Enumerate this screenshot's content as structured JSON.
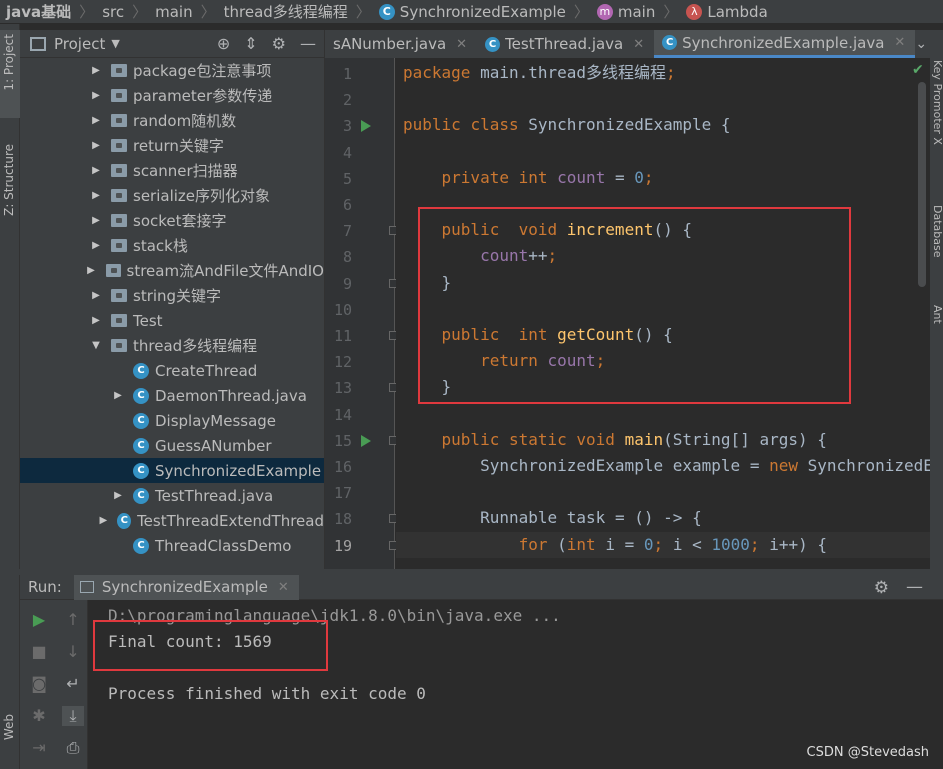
{
  "breadcrumb": [
    "java基础",
    "src",
    "main",
    "thread多线程编程",
    "SynchronizedExample",
    "main",
    "Lambda"
  ],
  "left_strip": {
    "project": "1: Project",
    "structure": "Z: Structure",
    "web": "Web"
  },
  "right_strip": {
    "key_promoter": "Key Promoter X",
    "database": "Database",
    "ant": "Ant"
  },
  "project_panel": {
    "title": "Project",
    "items": [
      {
        "label": "package包注意事项",
        "kind": "folder",
        "arrow": "▶"
      },
      {
        "label": "parameter参数传递",
        "kind": "folder",
        "arrow": "▶"
      },
      {
        "label": "random随机数",
        "kind": "folder",
        "arrow": "▶"
      },
      {
        "label": "return关键字",
        "kind": "folder",
        "arrow": "▶"
      },
      {
        "label": "scanner扫描器",
        "kind": "folder",
        "arrow": "▶"
      },
      {
        "label": "serialize序列化对象",
        "kind": "folder",
        "arrow": "▶"
      },
      {
        "label": "socket套接字",
        "kind": "folder",
        "arrow": "▶"
      },
      {
        "label": "stack栈",
        "kind": "folder",
        "arrow": "▶"
      },
      {
        "label": "stream流AndFile文件AndIO",
        "kind": "folder",
        "arrow": "▶"
      },
      {
        "label": "string关键字",
        "kind": "folder",
        "arrow": "▶"
      },
      {
        "label": "Test",
        "kind": "folder",
        "arrow": "▶"
      },
      {
        "label": "thread多线程编程",
        "kind": "folder",
        "arrow": "▼"
      },
      {
        "label": "CreateThread",
        "kind": "class",
        "arrow": ""
      },
      {
        "label": "DaemonThread.java",
        "kind": "class",
        "arrow": "▶"
      },
      {
        "label": "DisplayMessage",
        "kind": "class",
        "arrow": ""
      },
      {
        "label": "GuessANumber",
        "kind": "class",
        "arrow": ""
      },
      {
        "label": "SynchronizedExample",
        "kind": "class",
        "arrow": "",
        "selected": true
      },
      {
        "label": "TestThread.java",
        "kind": "class",
        "arrow": "▶"
      },
      {
        "label": "TestThreadExtendThread",
        "kind": "class",
        "arrow": "▶"
      },
      {
        "label": "ThreadClassDemo",
        "kind": "class",
        "arrow": ""
      }
    ]
  },
  "tabs": [
    {
      "label": "sANumber.java",
      "active": false
    },
    {
      "label": "TestThread.java",
      "active": false
    },
    {
      "label": "SynchronizedExample.java",
      "active": true
    }
  ],
  "editor": {
    "line_numbers": [
      "1",
      "2",
      "3",
      "4",
      "5",
      "6",
      "7",
      "8",
      "9",
      "10",
      "11",
      "12",
      "13",
      "14",
      "15",
      "16",
      "17",
      "18",
      "19"
    ],
    "current_line": "19",
    "code": [
      "package main.thread多线程编程;",
      "",
      "public class SynchronizedExample {",
      "",
      "    private int count = 0;",
      "",
      "    public  void increment() {",
      "        count++;",
      "    }",
      "",
      "    public  int getCount() {",
      "        return count;",
      "    }",
      "",
      "    public static void main(String[] args) {",
      "        SynchronizedExample example = new SynchronizedExample();",
      "",
      "        Runnable task = () -> {",
      "            for (int i = 0; i < 1000; i++) {"
    ]
  },
  "run_panel": {
    "label": "Run:",
    "tab": "SynchronizedExample",
    "console": [
      "D:\\programinglanguage\\jdk1.8.0\\bin\\java.exe ...",
      "Final count: 1569",
      "",
      "Process finished with exit code 0"
    ]
  },
  "watermark": "CSDN @Stevedash",
  "colors": {
    "highlight_box": "#e0393e",
    "keyword": "#cc7832",
    "field": "#9876aa",
    "number": "#6897bb",
    "method": "#ffc66d",
    "run_icon": "#499c54"
  }
}
